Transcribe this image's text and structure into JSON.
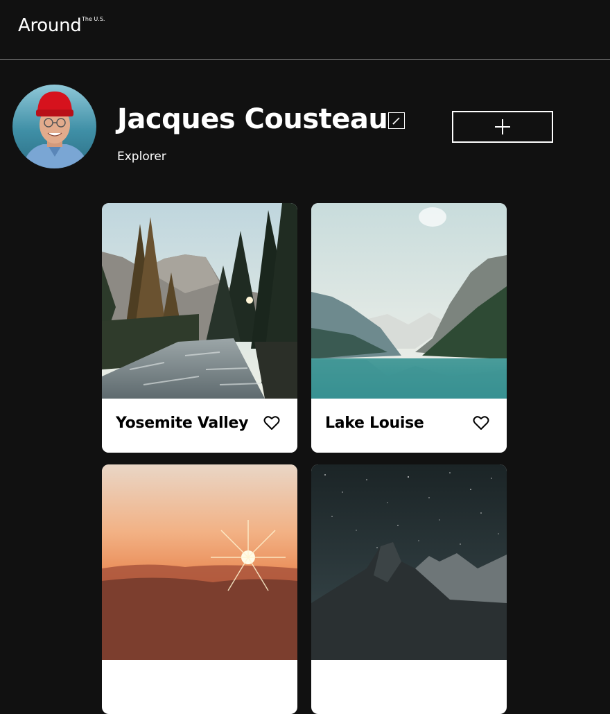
{
  "header": {
    "logo": "Around",
    "logo_superscript": "The U.S."
  },
  "profile": {
    "name": "Jacques Cousteau",
    "job": "Explorer"
  },
  "cards": [
    {
      "title": "Yosemite Valley",
      "image_icon": "forest-river-photo"
    },
    {
      "title": "Lake Louise",
      "image_icon": "mountain-lake-photo"
    },
    {
      "title": "",
      "image_icon": "sunset-photo"
    },
    {
      "title": "",
      "image_icon": "starry-mountain-photo"
    }
  ],
  "colors": {
    "background": "#111111",
    "card_background": "#ffffff",
    "text": "#ffffff",
    "card_text": "#000000",
    "divider": "#7a7a7a"
  }
}
